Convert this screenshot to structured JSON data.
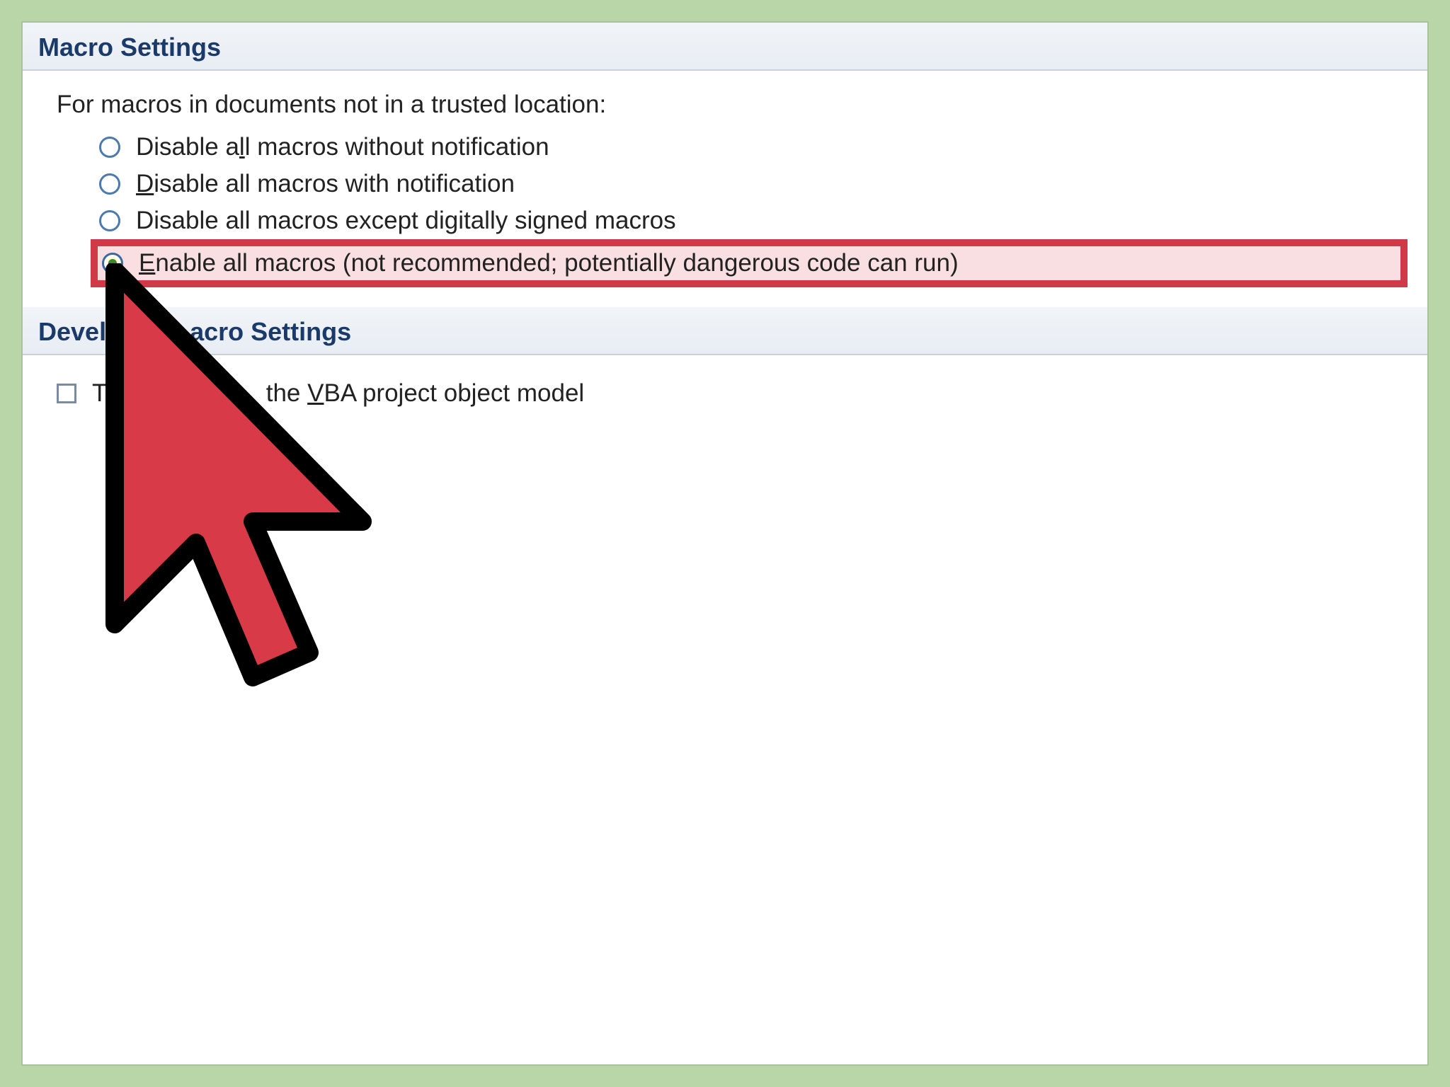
{
  "sections": {
    "macro": {
      "header": "Macro Settings",
      "intro": "For macros in documents not in a trusted location:",
      "options": [
        {
          "pre": "Disable a",
          "u": "l",
          "post": "l macros without notification",
          "selected": false
        },
        {
          "pre": "",
          "u": "D",
          "post": "isable all macros with notification",
          "selected": false
        },
        {
          "pre": "Disable all macros except di",
          "u": "g",
          "post": "itally signed macros",
          "selected": false
        },
        {
          "pre": "",
          "u": "E",
          "post": "nable all macros (not recommended; potentially dangerous code can run)",
          "selected": true
        }
      ]
    },
    "developer": {
      "header_pre": "Devel",
      "header_post": "acro Settings",
      "checkbox": {
        "pre": "T",
        "mid": "the ",
        "u": "V",
        "post": "BA project object model",
        "checked": false
      }
    }
  }
}
